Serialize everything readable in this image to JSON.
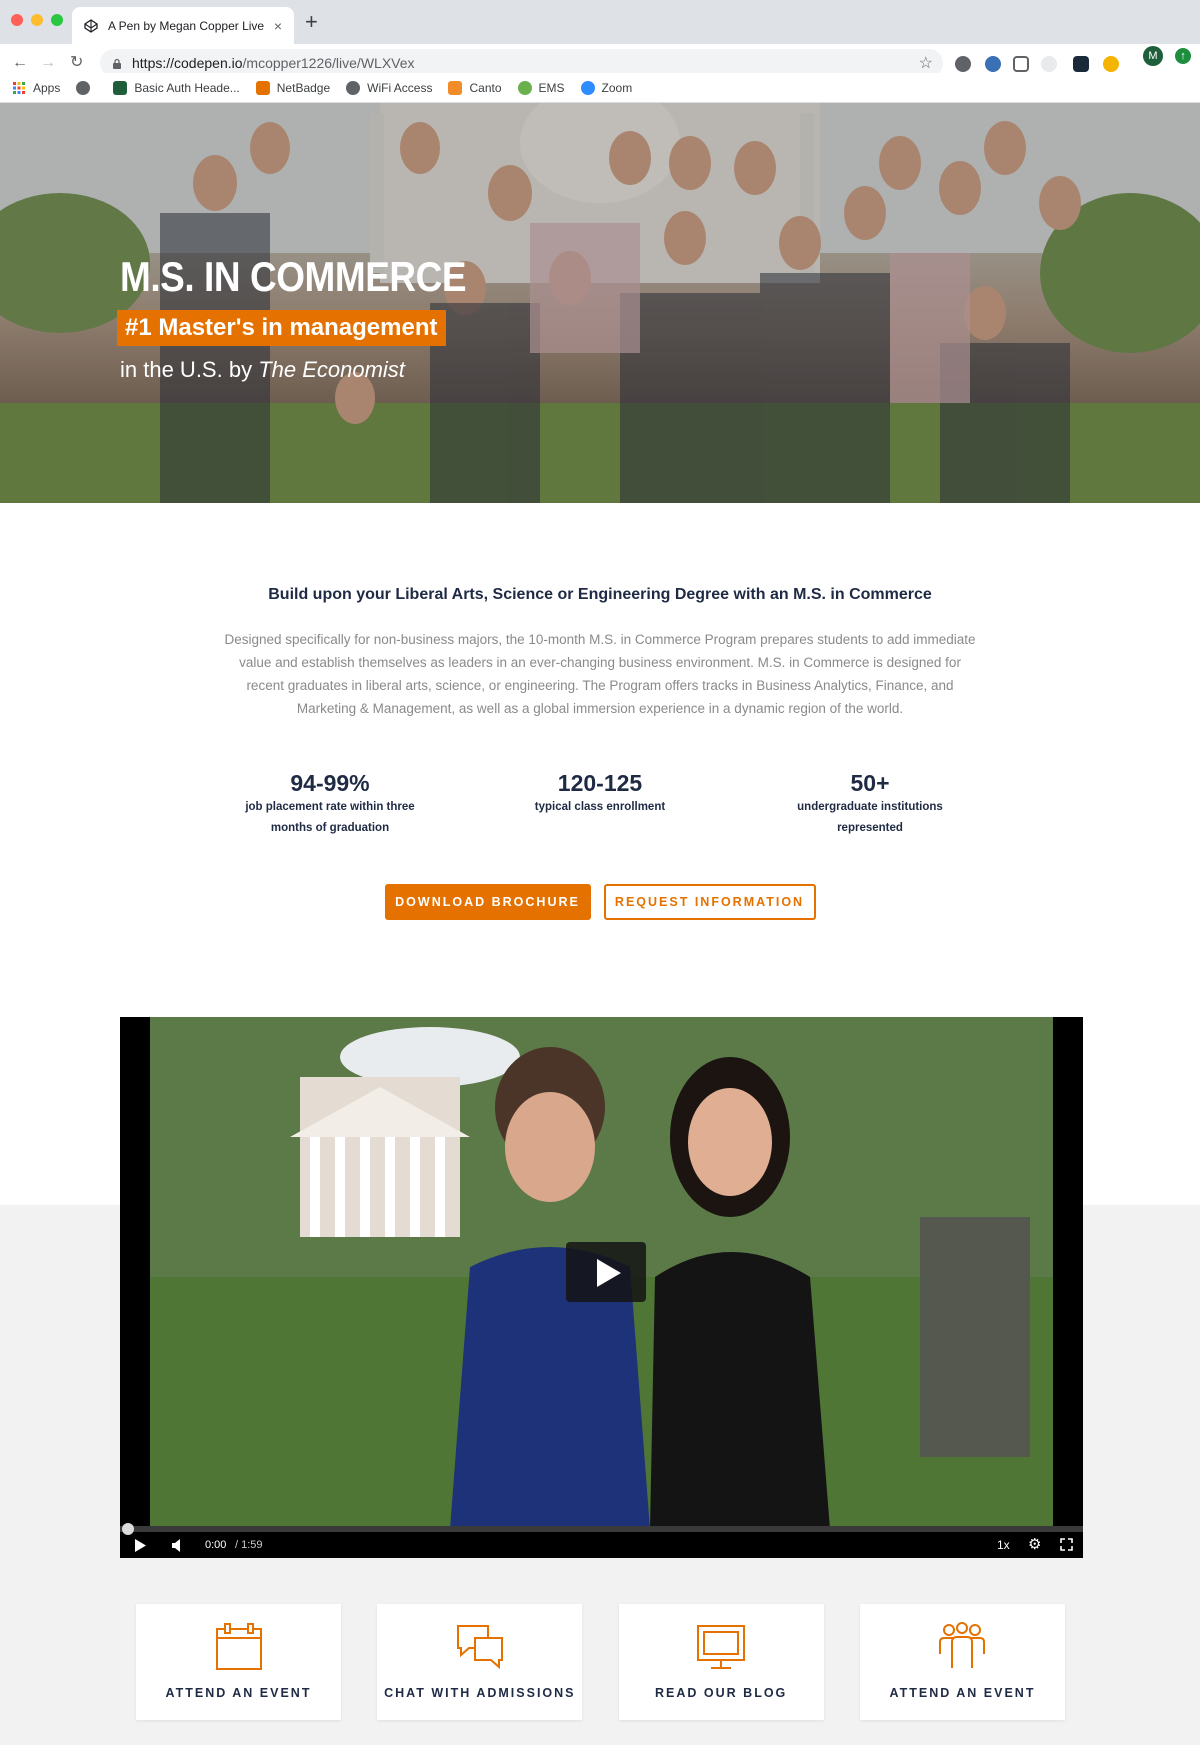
{
  "browser": {
    "tab_title": "A Pen by Megan Copper Live P",
    "url_host": "https://codepen.io",
    "url_path": "/mcopper1226/live/WLXVex",
    "new_tab_symbol": "+",
    "close_symbol": "×",
    "profile_initial": "M",
    "bookmarks": [
      {
        "label": "Apps",
        "icon": "apps-grid-icon",
        "color": "#ea4335"
      },
      {
        "label": "",
        "icon": "globe-icon",
        "color": "#5f6368"
      },
      {
        "label": "Basic Auth Heade...",
        "icon": "extension-icon",
        "color": "#1e5e3b"
      },
      {
        "label": "NetBadge",
        "icon": "netbadge-icon",
        "color": "#e57200"
      },
      {
        "label": "WiFi Access",
        "icon": "globe-icon",
        "color": "#5f6368"
      },
      {
        "label": "Canto",
        "icon": "canto-icon",
        "color": "#f28c28"
      },
      {
        "label": "EMS",
        "icon": "ems-icon",
        "color": "#6ab04c"
      },
      {
        "label": "Zoom",
        "icon": "zoom-icon",
        "color": "#2d8cff"
      }
    ]
  },
  "hero": {
    "title": "M.S. IN COMMERCE",
    "tag": "#1 Master's in management",
    "sub_prefix": "in the U.S. by ",
    "sub_italic": "The Economist"
  },
  "intro": {
    "heading": "Build upon your Liberal Arts, Science or Engineering Degree with an M.S. in Commerce",
    "body": "Designed specifically for non-business majors, the 10-month M.S. in Commerce Program prepares students to add immediate value and establish themselves as leaders in an ever-changing business environment. M.S. in Commerce is designed for recent graduates in liberal arts, science, or engineering. The Program offers tracks in Business Analytics, Finance, and Marketing & Management, as well as a global immersion experience in a dynamic region of the world."
  },
  "stats": [
    {
      "value": "94-99%",
      "label": "job placement rate within three months of graduation"
    },
    {
      "value": "120-125",
      "label": "typical class enrollment"
    },
    {
      "value": "50+",
      "label": "undergraduate institutions represented"
    }
  ],
  "buttons": {
    "download": "DOWNLOAD BROCHURE",
    "request": "REQUEST INFORMATION"
  },
  "video": {
    "current_time": "0:00",
    "total_time": "/ 1:59",
    "speed": "1x",
    "progress": 0
  },
  "cards": [
    {
      "label": "ATTEND AN EVENT",
      "icon": "calendar-icon"
    },
    {
      "label": "CHAT WITH ADMISSIONS",
      "icon": "chat-bubbles-icon"
    },
    {
      "label": "READ OUR BLOG",
      "icon": "monitor-icon"
    },
    {
      "label": "ATTEND AN EVENT",
      "icon": "people-group-icon"
    }
  ],
  "colors": {
    "accent": "#e57200",
    "navy": "#1f2a44",
    "muted_text": "#8a8a8a",
    "band_grey": "#f2f2f2"
  }
}
